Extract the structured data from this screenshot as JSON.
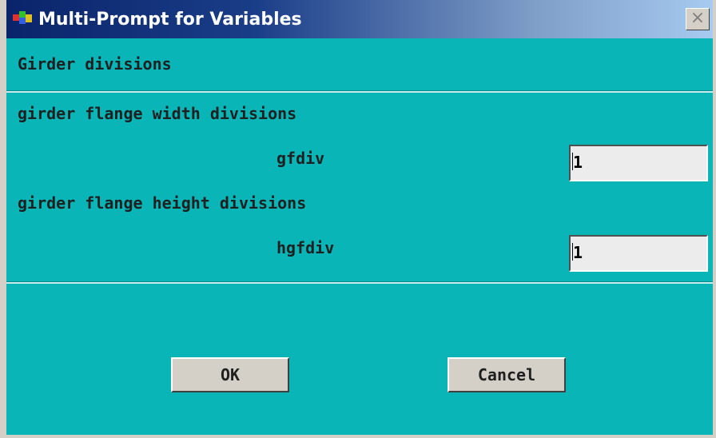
{
  "window": {
    "title": "Multi-Prompt for Variables",
    "close_label": "×"
  },
  "header": {
    "heading": "Girder divisions"
  },
  "prompts": [
    {
      "description": "girder flange width divisions",
      "variable": "gfdiv",
      "value": "1"
    },
    {
      "description": "girder flange height divisions",
      "variable": "hgfdiv",
      "value": "1"
    }
  ],
  "buttons": {
    "ok_label": "OK",
    "cancel_label": "Cancel"
  },
  "colors": {
    "background": "#0ab5b8",
    "titlebar_start": "#0a246a",
    "titlebar_end": "#a6caf0",
    "button_face": "#d4d0c8"
  },
  "icons": {
    "app": "ansys-app-icon",
    "close": "close-icon"
  }
}
